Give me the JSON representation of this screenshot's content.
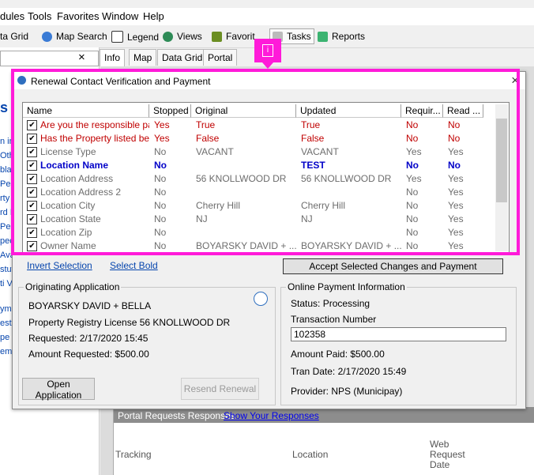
{
  "app": {
    "menu": [
      "dules",
      "Tools",
      "Favorites",
      "Window",
      "Help"
    ],
    "toolbar": [
      "ta Grid",
      "Map Search",
      "Legend",
      "Views",
      "Favorit",
      "Tasks",
      "Reports"
    ],
    "panel_tabs": [
      "Info",
      "Map",
      "Data Grid",
      "Portal"
    ],
    "panel_close": "×",
    "left_letter": "s",
    "left_links": [
      "n in",
      "Oth",
      "blai",
      "Pen",
      "rty I",
      "rd R",
      "Pen",
      "pec",
      "Ava",
      "stut",
      "ti V",
      "ym",
      "est",
      "pe",
      "em"
    ]
  },
  "dialog": {
    "title": "Renewal Contact Verification and Payment",
    "close": "×",
    "grid": {
      "columns": [
        "Name",
        "Stopped",
        "Original",
        "Updated",
        "Requir...",
        "Read ..."
      ],
      "rows": [
        {
          "check": "✔",
          "name": "Are you the responsible par...",
          "stopped": "Yes",
          "original": "True",
          "updated": "True",
          "required": "No",
          "read": "No",
          "style": "red"
        },
        {
          "check": "✔",
          "name": "Has the Property listed belo...",
          "stopped": "Yes",
          "original": "False",
          "updated": "False",
          "required": "No",
          "read": "No",
          "style": "red"
        },
        {
          "check": "✔",
          "name": "License Type",
          "stopped": "No",
          "original": "VACANT",
          "updated": "VACANT",
          "required": "Yes",
          "read": "Yes",
          "style": "gray"
        },
        {
          "check": "✔",
          "name": "Location Name",
          "stopped": "No",
          "original": "",
          "updated": "TEST",
          "required": "No",
          "read": "No",
          "style": "bold"
        },
        {
          "check": "✔",
          "name": "Location Address",
          "stopped": "No",
          "original": "56 KNOLLWOOD DR",
          "updated": "56 KNOLLWOOD DR",
          "required": "Yes",
          "read": "Yes",
          "style": "gray"
        },
        {
          "check": "✔",
          "name": "Location Address 2",
          "stopped": "No",
          "original": "",
          "updated": "",
          "required": "No",
          "read": "Yes",
          "style": "gray"
        },
        {
          "check": "✔",
          "name": "Location City",
          "stopped": "No",
          "original": "Cherry Hill",
          "updated": "Cherry Hill",
          "required": "No",
          "read": "Yes",
          "style": "gray"
        },
        {
          "check": "✔",
          "name": "Location State",
          "stopped": "No",
          "original": "NJ",
          "updated": "NJ",
          "required": "No",
          "read": "Yes",
          "style": "gray"
        },
        {
          "check": "✔",
          "name": "Location Zip",
          "stopped": "No",
          "original": "",
          "updated": "",
          "required": "No",
          "read": "Yes",
          "style": "gray"
        },
        {
          "check": "✔",
          "name": "Owner Name",
          "stopped": "No",
          "original": "BOYARSKY DAVID + ...",
          "updated": "BOYARSKY DAVID + ...",
          "required": "No",
          "read": "Yes",
          "style": "gray"
        }
      ]
    },
    "invert_selection": "Invert Selection",
    "select_bold": "Select Bold",
    "accept_button": "Accept Selected Changes and Payment",
    "originating": {
      "title": "Originating Application",
      "applicant": "BOYARSKY DAVID + BELLA",
      "property": "Property Registry License 56 KNOLLWOOD DR",
      "requested": "Requested: 2/17/2020 15:45",
      "amount": "Amount Requested: $500.00",
      "open_button": "Open Application",
      "resend_button": "Resend Renewal"
    },
    "payment": {
      "title": "Online Payment Information",
      "status": "Status: Processing",
      "transaction_label": "Transaction Number",
      "transaction_value": "102358",
      "amount_paid": "Amount Paid: $500.00",
      "tran_date": "Tran Date: 2/17/2020 15:49",
      "provider": "Provider: NPS (Municipay)"
    }
  },
  "portal": {
    "header": "Portal Requests Responses",
    "link": "Show Your Responses",
    "columns": [
      "Tracking",
      "Location",
      "Web",
      "Request",
      "Date"
    ]
  },
  "highlight_badge": "i",
  "colors": {
    "highlight": "#ff1ad9",
    "link": "#0645ad",
    "changed": "#0000c8",
    "stopped": "#c00000"
  }
}
